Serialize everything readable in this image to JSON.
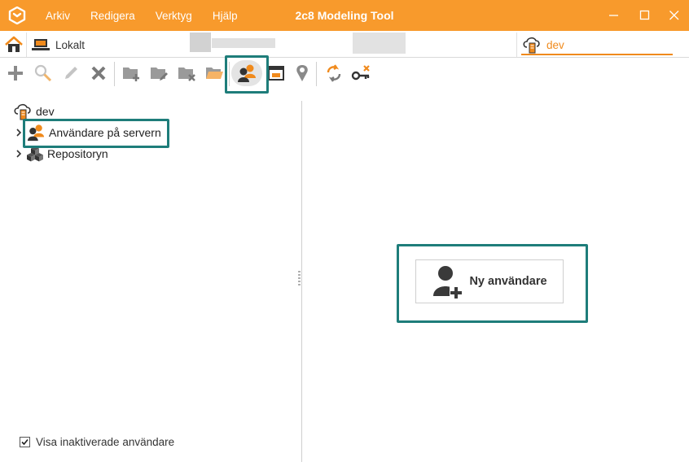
{
  "titlebar": {
    "title": "2c8 Modeling Tool",
    "menu": [
      "Arkiv",
      "Redigera",
      "Verktyg",
      "Hjälp"
    ]
  },
  "tabs": {
    "local_label": "Lokalt",
    "dev_label": "dev"
  },
  "toolbar": {
    "icons": [
      "add-icon",
      "search-icon",
      "edit-icon",
      "delete-icon",
      "new-folder-icon",
      "edit-folder-icon",
      "delete-folder-icon",
      "open-folder-icon",
      "users-icon",
      "window-icon",
      "location-pin-icon",
      "sync-icon",
      "key-icon"
    ]
  },
  "tree": {
    "root_label": "dev",
    "items": [
      {
        "label": "Användare på servern"
      },
      {
        "label": "Repositoryn"
      }
    ]
  },
  "options": {
    "show_inactive_label": "Visa inaktiverade användare",
    "show_inactive_checked": true
  },
  "main": {
    "new_user_label": "Ny användare"
  },
  "colors": {
    "accent": "#f89a2c",
    "highlight": "#1e7d7a"
  }
}
